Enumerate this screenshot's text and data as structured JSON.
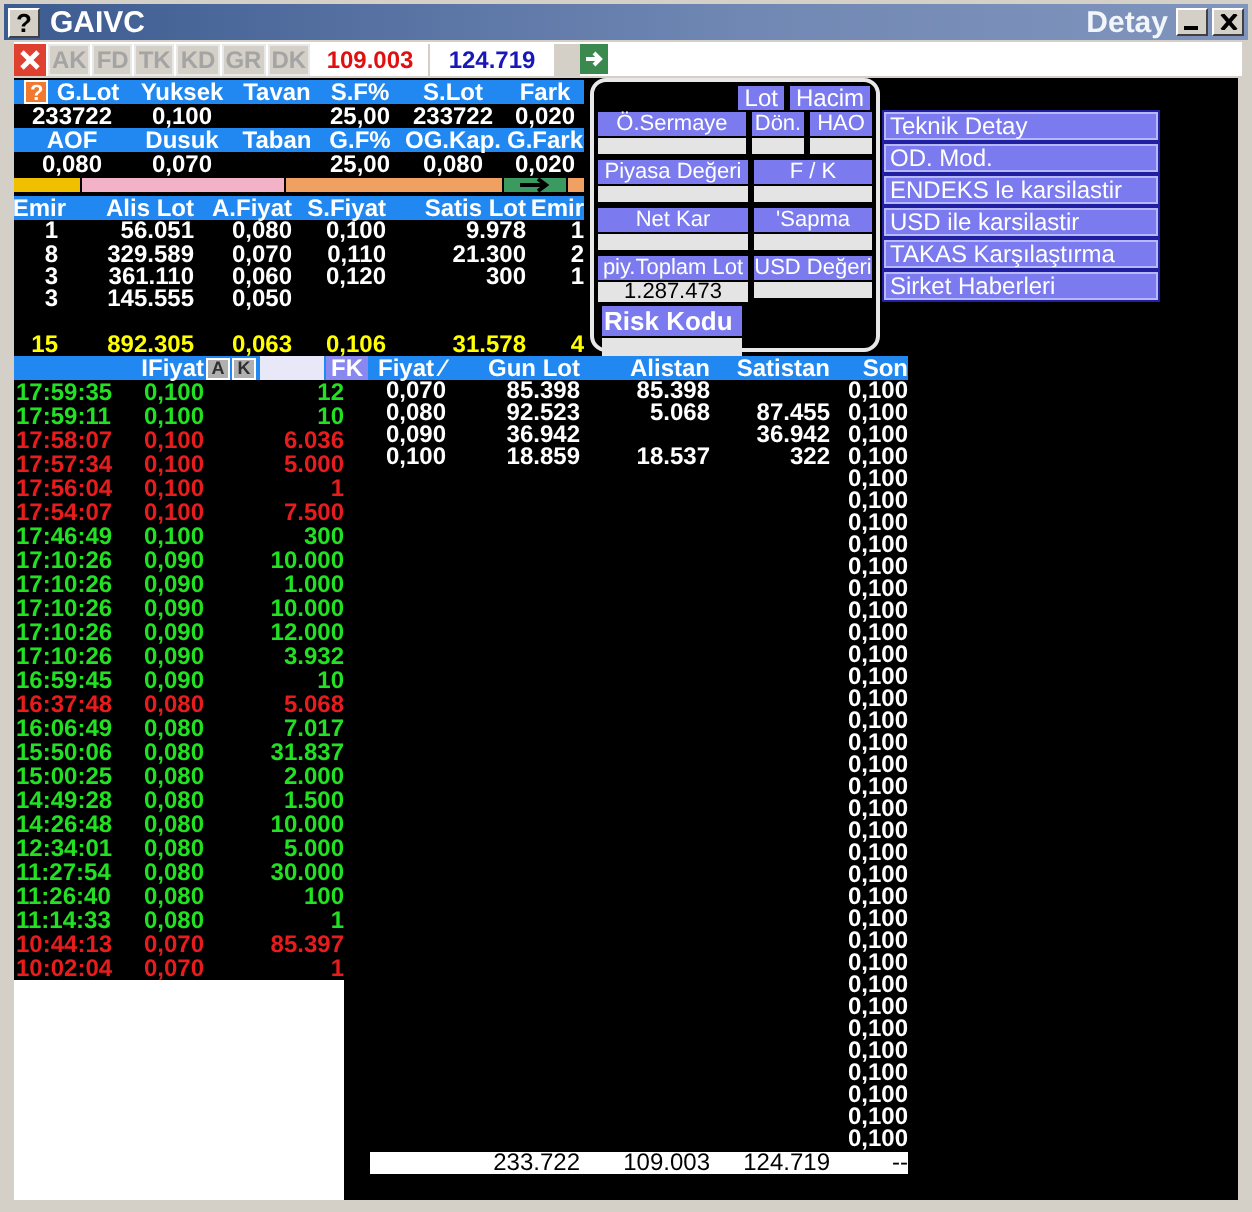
{
  "window": {
    "icon": "?",
    "title": "GAIVC",
    "subtitle": "Detay"
  },
  "toolbar": {
    "tabs": [
      {
        "label": "AK",
        "disabled": true
      },
      {
        "label": "FD",
        "disabled": true
      },
      {
        "label": "TK",
        "disabled": true
      },
      {
        "label": "KD",
        "disabled": true
      },
      {
        "label": "GR",
        "disabled": true
      },
      {
        "label": "DK",
        "disabled": true
      }
    ],
    "fields": [
      {
        "value": "109.003",
        "color": "#e01010"
      },
      {
        "value": "124.719",
        "color": "#1818b8"
      }
    ]
  },
  "summary": {
    "help": "?",
    "rows": [
      [
        {
          "label": "G.Lot",
          "value": "233722"
        },
        {
          "label": "Yuksek",
          "value": "0,100"
        },
        {
          "label": "Tavan"
        },
        {
          "label": "S.F%",
          "value": "25,00"
        },
        {
          "label": "S.Lot",
          "value": "233722"
        },
        {
          "label": "Fark",
          "value": "0,020"
        }
      ],
      [
        {
          "label": "AOF",
          "value": "0,080"
        },
        {
          "label": "Dusuk",
          "value": "0,070"
        },
        {
          "label": "Taban"
        },
        {
          "label": "G.F%",
          "value": "25,00"
        },
        {
          "label": "OG.Kap.",
          "value": "0,080"
        },
        {
          "label": "G.Fark",
          "value": "0,020"
        }
      ]
    ]
  },
  "order_book": {
    "columns": [
      "Emir",
      "Alis Lot",
      "A.Fiyat",
      "S.Fiyat",
      "Satis Lot",
      "Emir"
    ],
    "rows": [
      [
        "1",
        "56.051",
        "0,080",
        "0,100",
        "9.978",
        "1"
      ],
      [
        "8",
        "329.589",
        "0,070",
        "0,110",
        "21.300",
        "2"
      ],
      [
        "3",
        "361.110",
        "0,060",
        "0,120",
        "300",
        "1"
      ],
      [
        "3",
        "145.555",
        "0,050"
      ]
    ],
    "totals": [
      "15",
      "892.305",
      "0,063",
      "0,106",
      "31.578",
      "4"
    ]
  },
  "detail_panel": {
    "buttons": [
      "Lot",
      "Hacim"
    ],
    "rows": [
      [
        {
          "label": "Ö.Sermaye"
        },
        {
          "label": "Dön."
        },
        {
          "label": "HAO"
        }
      ],
      [
        {
          "label": "Piyasa Değeri"
        },
        {
          "label": "F / K"
        }
      ],
      [
        {
          "label": "Net Kar"
        },
        {
          "label": "'Sapma"
        }
      ],
      [
        {
          "label": "piy.Toplam Lot",
          "value": "1.287.473"
        },
        {
          "label": "USD Değeri"
        }
      ],
      [
        {
          "label": "Risk Kodu"
        }
      ]
    ]
  },
  "menu": [
    "Teknik Detay",
    "OD. Mod.",
    "ENDEKS le karsilastir",
    "USD ile karsilastir",
    "TAKAS Karşılaştırma",
    "Sirket Haberleri"
  ],
  "trades": {
    "header": {
      "label": "IFiyat",
      "buttons": [
        "A",
        "K"
      ],
      "filter_button": "FK"
    },
    "rows": [
      {
        "time": "17:59:35",
        "price": "0,100",
        "lot": "12",
        "kind": "up"
      },
      {
        "time": "17:59:11",
        "price": "0,100",
        "lot": "10",
        "kind": "up"
      },
      {
        "time": "17:58:07",
        "price": "0,100",
        "lot": "6.036",
        "kind": "down"
      },
      {
        "time": "17:57:34",
        "price": "0,100",
        "lot": "5.000",
        "kind": "down"
      },
      {
        "time": "17:56:04",
        "price": "0,100",
        "lot": "1",
        "kind": "down"
      },
      {
        "time": "17:54:07",
        "price": "0,100",
        "lot": "7.500",
        "kind": "down"
      },
      {
        "time": "17:46:49",
        "price": "0,100",
        "lot": "300",
        "kind": "up"
      },
      {
        "time": "17:10:26",
        "price": "0,090",
        "lot": "10.000",
        "kind": "up"
      },
      {
        "time": "17:10:26",
        "price": "0,090",
        "lot": "1.000",
        "kind": "up"
      },
      {
        "time": "17:10:26",
        "price": "0,090",
        "lot": "10.000",
        "kind": "up"
      },
      {
        "time": "17:10:26",
        "price": "0,090",
        "lot": "12.000",
        "kind": "up"
      },
      {
        "time": "17:10:26",
        "price": "0,090",
        "lot": "3.932",
        "kind": "up"
      },
      {
        "time": "16:59:45",
        "price": "0,090",
        "lot": "10",
        "kind": "up"
      },
      {
        "time": "16:37:48",
        "price": "0,080",
        "lot": "5.068",
        "kind": "down"
      },
      {
        "time": "16:06:49",
        "price": "0,080",
        "lot": "7.017",
        "kind": "up"
      },
      {
        "time": "15:50:06",
        "price": "0,080",
        "lot": "31.837",
        "kind": "up"
      },
      {
        "time": "15:00:25",
        "price": "0,080",
        "lot": "2.000",
        "kind": "up"
      },
      {
        "time": "14:49:28",
        "price": "0,080",
        "lot": "1.500",
        "kind": "up"
      },
      {
        "time": "14:26:48",
        "price": "0,080",
        "lot": "10.000",
        "kind": "up"
      },
      {
        "time": "12:34:01",
        "price": "0,080",
        "lot": "5.000",
        "kind": "up"
      },
      {
        "time": "11:27:54",
        "price": "0,080",
        "lot": "30.000",
        "kind": "up"
      },
      {
        "time": "11:26:40",
        "price": "0,080",
        "lot": "100",
        "kind": "up"
      },
      {
        "time": "11:14:33",
        "price": "0,080",
        "lot": "1",
        "kind": "up"
      },
      {
        "time": "10:44:13",
        "price": "0,070",
        "lot": "85.397",
        "kind": "down"
      },
      {
        "time": "10:02:04",
        "price": "0,070",
        "lot": "1",
        "kind": "down"
      }
    ]
  },
  "price_table": {
    "columns": [
      "Fiyat ∕",
      "Gun Lot",
      "Alistan",
      "Satistan",
      "Son"
    ],
    "rows": [
      {
        "fiyat": "0,070",
        "gun_lot": "85.398",
        "alistan": "85.398",
        "son": "0,100"
      },
      {
        "fiyat": "0,080",
        "gun_lot": "92.523",
        "alistan": "5.068",
        "satistan": "87.455",
        "son": "0,100"
      },
      {
        "fiyat": "0,090",
        "gun_lot": "36.942",
        "satistan": "36.942",
        "son": "0,100"
      },
      {
        "fiyat": "0,100",
        "gun_lot": "18.859",
        "alistan": "18.537",
        "satistan": "322",
        "son": "0,100"
      },
      {
        "son": "0,100"
      },
      {
        "son": "0,100"
      },
      {
        "son": "0,100"
      },
      {
        "son": "0,100"
      },
      {
        "son": "0,100"
      },
      {
        "son": "0,100"
      },
      {
        "son": "0,100"
      },
      {
        "son": "0,100"
      },
      {
        "son": "0,100"
      },
      {
        "son": "0,100"
      },
      {
        "son": "0,100"
      },
      {
        "son": "0,100"
      },
      {
        "son": "0,100"
      },
      {
        "son": "0,100"
      },
      {
        "son": "0,100"
      },
      {
        "son": "0,100"
      },
      {
        "son": "0,100"
      },
      {
        "son": "0,100"
      },
      {
        "son": "0,100"
      },
      {
        "son": "0,100"
      },
      {
        "son": "0,100"
      },
      {
        "son": "0,100"
      },
      {
        "son": "0,100"
      },
      {
        "son": "0,100"
      },
      {
        "son": "0,100"
      },
      {
        "son": "0,100"
      },
      {
        "son": "0,100"
      },
      {
        "son": "0,100"
      },
      {
        "son": "0,100"
      },
      {
        "son": "0,100"
      },
      {
        "son": "0,100"
      }
    ],
    "totals": {
      "gun_lot": "233.722",
      "alistan": "109.003",
      "satistan": "124.719",
      "son": "--"
    }
  }
}
